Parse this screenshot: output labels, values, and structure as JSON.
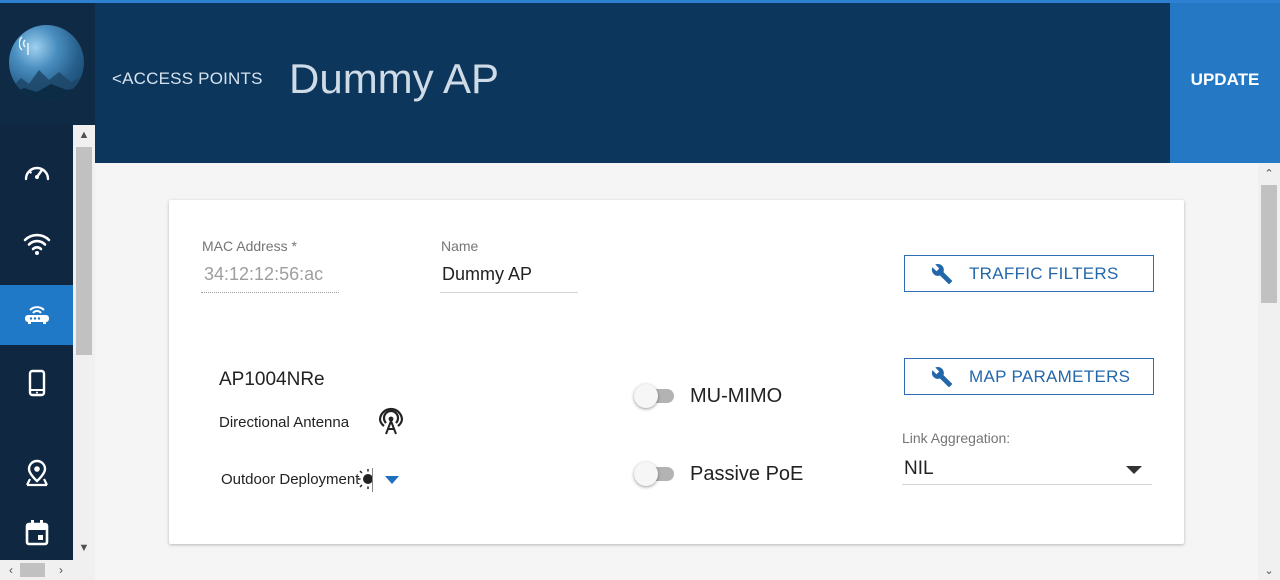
{
  "colors": {
    "sidebar_bg": "#0e2a45",
    "header_bg": "#0c365c",
    "accent": "#2579c4",
    "card_bg": "#ffffff"
  },
  "sidebar": {
    "logo_icon": "wireless-globe-logo",
    "items": [
      {
        "icon": "speedometer-icon",
        "active": false
      },
      {
        "icon": "wifi-icon",
        "active": false
      },
      {
        "icon": "router-icon",
        "active": true
      },
      {
        "icon": "phone-icon",
        "active": false
      },
      {
        "icon": "map-marker-icon",
        "active": false
      },
      {
        "icon": "calendar-icon",
        "active": false
      }
    ]
  },
  "header": {
    "back_label": "<ACCESS POINTS",
    "title": "Dummy AP",
    "update_label": "UPDATE"
  },
  "form": {
    "mac": {
      "label": "MAC Address *",
      "value": "34:12:12:56:ac"
    },
    "name": {
      "label": "Name",
      "value": "Dummy AP"
    },
    "traffic_filters_label": "TRAFFIC FILTERS",
    "map_parameters_label": "MAP PARAMETERS",
    "model": "AP1004NRe",
    "directional_antenna_label": "Directional Antenna",
    "outdoor_deployment_label": "Outdoor Deployment",
    "mu_mimo": {
      "label": "MU-MIMO",
      "enabled": false
    },
    "passive_poe": {
      "label": "Passive PoE",
      "enabled": false
    },
    "link_aggregation": {
      "label": "Link Aggregation:",
      "value": "NIL"
    }
  }
}
